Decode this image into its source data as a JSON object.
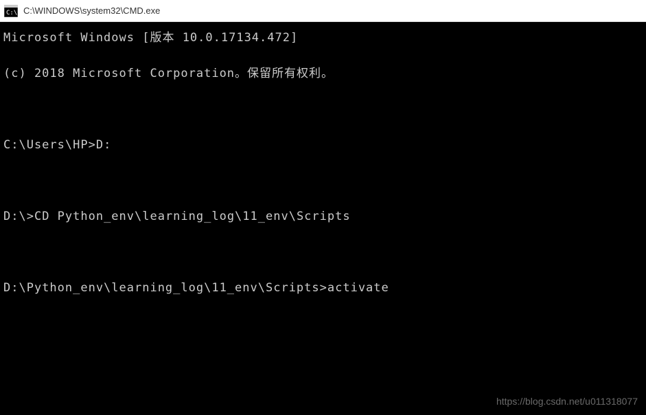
{
  "window": {
    "title": "C:\\WINDOWS\\system32\\CMD.exe"
  },
  "terminal": {
    "lines": [
      {
        "type": "output",
        "text": "Microsoft Windows [版本 10.0.17134.472]"
      },
      {
        "type": "output",
        "text": "(c) 2018 Microsoft Corporation。保留所有权利。"
      },
      {
        "type": "blank",
        "text": ""
      },
      {
        "type": "command",
        "prompt": "C:\\Users\\HP>",
        "input": "D:"
      },
      {
        "type": "blank",
        "text": ""
      },
      {
        "type": "command",
        "prompt": "D:\\>",
        "input": "CD Python_env\\learning_log\\11_env\\Scripts"
      },
      {
        "type": "blank",
        "text": ""
      },
      {
        "type": "command",
        "prompt": "D:\\Python_env\\learning_log\\11_env\\Scripts>",
        "input": "activate"
      }
    ]
  },
  "watermark": "https://blog.csdn.net/u011318077"
}
